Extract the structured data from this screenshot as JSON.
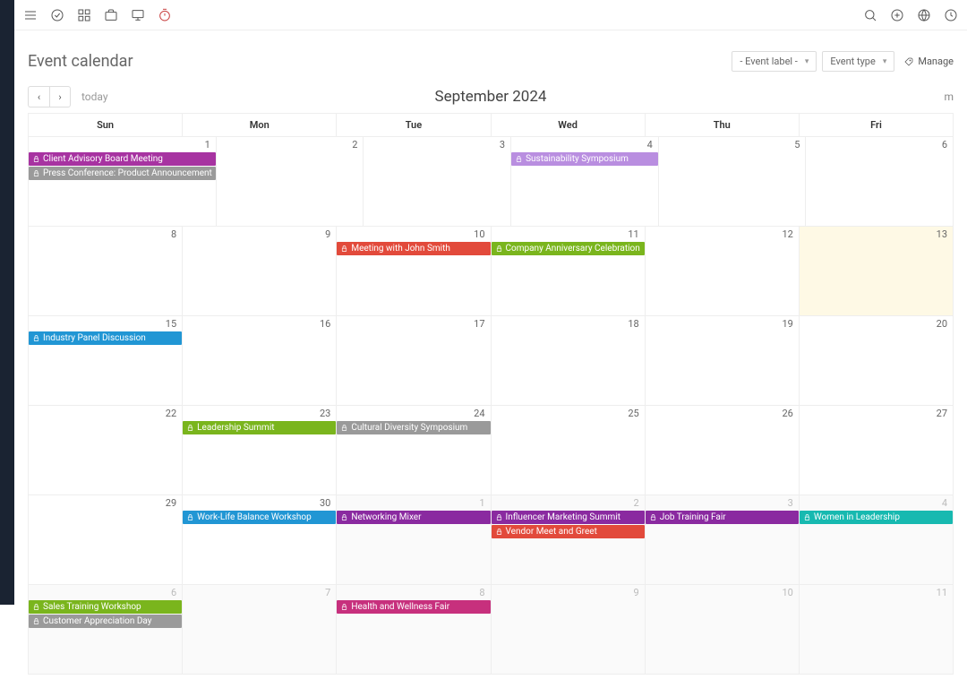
{
  "pageTitle": "Event calendar",
  "filters": {
    "labelSelect": "- Event label -",
    "typeSelect": "Event type",
    "manageLabel": "Manage"
  },
  "nav": {
    "today": "today",
    "title": "September 2024",
    "viewLetter": "m"
  },
  "dow": [
    "Sun",
    "Mon",
    "Tue",
    "Wed",
    "Thu",
    "Fri"
  ],
  "colors": {
    "purple": "#a733a1",
    "gray": "#9a9a9a",
    "lilac": "#b98ee0",
    "red": "#e24a3b",
    "green": "#7ab51d",
    "blue": "#2196d4",
    "darkPurple": "#8a2aa0",
    "magenta": "#c7307d",
    "teal": "#17b9b0"
  },
  "weeks": [
    {
      "days": [
        {
          "num": "1",
          "events": [
            {
              "title": "Client Advisory Board Meeting",
              "color": "purple"
            },
            {
              "title": "Press Conference: Product Announcement",
              "color": "gray"
            }
          ]
        },
        {
          "num": "2"
        },
        {
          "num": "3"
        },
        {
          "num": "4",
          "events": [
            {
              "title": "Sustainability Symposium",
              "color": "lilac"
            }
          ]
        },
        {
          "num": "5"
        },
        {
          "num": "6"
        }
      ]
    },
    {
      "days": [
        {
          "num": "8"
        },
        {
          "num": "9"
        },
        {
          "num": "10",
          "events": [
            {
              "title": "Meeting with John Smith",
              "color": "red"
            }
          ]
        },
        {
          "num": "11",
          "events": [
            {
              "title": "Company Anniversary Celebration",
              "color": "green"
            }
          ]
        },
        {
          "num": "12"
        },
        {
          "num": "13",
          "today": true
        }
      ]
    },
    {
      "days": [
        {
          "num": "15",
          "events": [
            {
              "title": "Industry Panel Discussion",
              "color": "blue"
            }
          ]
        },
        {
          "num": "16"
        },
        {
          "num": "17"
        },
        {
          "num": "18"
        },
        {
          "num": "19"
        },
        {
          "num": "20"
        }
      ]
    },
    {
      "days": [
        {
          "num": "22"
        },
        {
          "num": "23",
          "events": [
            {
              "title": "Leadership Summit",
              "color": "green"
            }
          ]
        },
        {
          "num": "24",
          "events": [
            {
              "title": "Cultural Diversity Symposium",
              "color": "gray"
            }
          ]
        },
        {
          "num": "25"
        },
        {
          "num": "26"
        },
        {
          "num": "27"
        }
      ]
    },
    {
      "days": [
        {
          "num": "29"
        },
        {
          "num": "30",
          "events": [
            {
              "title": "Work-Life Balance Workshop",
              "color": "blue"
            }
          ]
        },
        {
          "num": "1",
          "out": true,
          "events": [
            {
              "title": "Networking Mixer",
              "color": "darkPurple"
            }
          ]
        },
        {
          "num": "2",
          "out": true,
          "events": [
            {
              "title": "Influencer Marketing Summit",
              "color": "darkPurple"
            },
            {
              "title": "Vendor Meet and Greet",
              "color": "red"
            }
          ]
        },
        {
          "num": "3",
          "out": true,
          "events": [
            {
              "title": "Job Training Fair",
              "color": "darkPurple"
            }
          ]
        },
        {
          "num": "4",
          "out": true,
          "events": [
            {
              "title": "Women in Leadership",
              "color": "teal"
            }
          ]
        }
      ]
    },
    {
      "days": [
        {
          "num": "6",
          "out": true,
          "events": [
            {
              "title": "Sales Training Workshop",
              "color": "green"
            },
            {
              "title": "Customer Appreciation Day",
              "color": "gray"
            }
          ]
        },
        {
          "num": "7",
          "out": true
        },
        {
          "num": "8",
          "out": true,
          "events": [
            {
              "title": "Health and Wellness Fair",
              "color": "magenta"
            }
          ]
        },
        {
          "num": "9",
          "out": true
        },
        {
          "num": "10",
          "out": true
        },
        {
          "num": "11",
          "out": true
        }
      ]
    }
  ]
}
